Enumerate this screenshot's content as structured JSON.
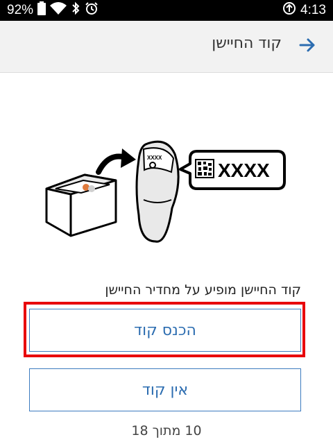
{
  "status": {
    "battery": "92%",
    "time": "4:13",
    "icons": [
      "battery-icon",
      "wifi-icon",
      "bluetooth-icon",
      "alarm-icon",
      "data-saver-icon"
    ]
  },
  "header": {
    "title": "קוד החיישן",
    "back_icon": "arrow-right-icon",
    "accent_color": "#2b6cb0"
  },
  "illustration": {
    "sensor_label": "XXXX",
    "callout_code": "XXXX"
  },
  "main": {
    "instruction": "קוד החיישן מופיע על מחדיר החיישן",
    "enter_code_button": "הכנס קוד",
    "no_code_button": "אין קוד",
    "progress": "10 מתוך 18"
  },
  "highlight_color": "#e8000b"
}
